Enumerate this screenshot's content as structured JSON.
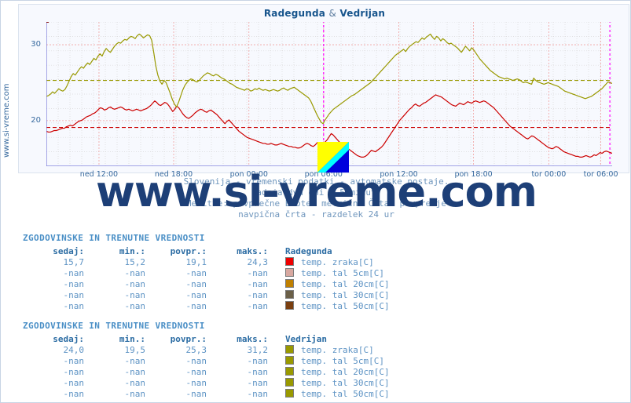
{
  "page": {
    "side_watermark": "www.si-vreme.com",
    "center_watermark": "www.si-vreme.com"
  },
  "chart": {
    "title_left": "Radegunda",
    "title_amp": "&",
    "title_right": "Vedrijan",
    "caption_line1": "Slovenija - vremenski podatki - avtomatske postaje.",
    "caption_line2": "zadnja dva dni / 5 minut.",
    "caption_line3": "Meritve: povprečne  Enote: metrične  Črta: povprečje",
    "caption_line4": "navpična črta - razdelek 24 ur",
    "logo_colors": {
      "top": "#ffff00",
      "mid": "#00ffff",
      "bottom": "#0000dd"
    }
  },
  "chart_data": {
    "type": "line",
    "title": "Radegunda & Vedrijan",
    "xlabel": "",
    "ylabel": "",
    "ylim": [
      14,
      33
    ],
    "yticks": [
      20,
      30
    ],
    "ytick_labels": [
      "20",
      "30"
    ],
    "grid": true,
    "xtick_labels": [
      "ned 12:00",
      "ned 18:00",
      "pon 00:00",
      "pon 06:00",
      "pon 12:00",
      "pon 18:00",
      "tor 00:00",
      "tor 06:00"
    ],
    "xtick_positions_pct": [
      9.3,
      22.5,
      35.8,
      49.0,
      62.3,
      75.5,
      88.8,
      98.0
    ],
    "day_divider_pct": [
      49.0,
      99.6
    ],
    "day_divider_color": "#ff00ff",
    "series": [
      {
        "name": "Radegunda temp. zraka[C]",
        "color": "#cc0000",
        "average": 19.1,
        "average_line_color": "#cc0000",
        "values": [
          18.6,
          18.5,
          18.5,
          18.6,
          18.7,
          18.7,
          18.8,
          18.9,
          19.0,
          19.0,
          19.2,
          19.3,
          19.4,
          19.3,
          19.5,
          19.7,
          19.9,
          20.0,
          20.1,
          20.3,
          20.5,
          20.6,
          20.7,
          20.9,
          21.0,
          21.2,
          21.5,
          21.7,
          21.6,
          21.4,
          21.5,
          21.7,
          21.8,
          21.6,
          21.5,
          21.6,
          21.7,
          21.8,
          21.7,
          21.5,
          21.4,
          21.5,
          21.4,
          21.3,
          21.4,
          21.5,
          21.4,
          21.3,
          21.4,
          21.5,
          21.6,
          21.8,
          22.0,
          22.3,
          22.6,
          22.4,
          22.1,
          22.0,
          22.2,
          22.4,
          22.3,
          22.0,
          21.6,
          21.2,
          21.5,
          21.9,
          21.7,
          21.3,
          20.9,
          20.6,
          20.4,
          20.3,
          20.5,
          20.7,
          21.0,
          21.2,
          21.4,
          21.5,
          21.4,
          21.2,
          21.1,
          21.3,
          21.4,
          21.2,
          21.0,
          20.8,
          20.5,
          20.2,
          19.9,
          19.6,
          19.9,
          20.1,
          19.8,
          19.5,
          19.2,
          18.9,
          18.6,
          18.4,
          18.2,
          18.0,
          17.8,
          17.7,
          17.6,
          17.5,
          17.4,
          17.3,
          17.2,
          17.1,
          17.0,
          17.0,
          16.9,
          16.9,
          17.0,
          16.9,
          16.8,
          16.8,
          16.9,
          17.0,
          16.9,
          16.8,
          16.7,
          16.6,
          16.6,
          16.5,
          16.5,
          16.4,
          16.4,
          16.5,
          16.7,
          16.9,
          17.0,
          16.9,
          16.7,
          16.6,
          16.8,
          17.1,
          17.0,
          16.8,
          16.9,
          17.2,
          17.5,
          17.9,
          18.3,
          18.1,
          17.8,
          17.5,
          17.2,
          17.0,
          16.8,
          16.6,
          16.4,
          16.2,
          16.0,
          15.8,
          15.6,
          15.4,
          15.3,
          15.2,
          15.2,
          15.3,
          15.5,
          15.8,
          16.1,
          16.0,
          15.9,
          16.1,
          16.3,
          16.5,
          16.8,
          17.2,
          17.6,
          18.0,
          18.4,
          18.8,
          19.2,
          19.6,
          20.0,
          20.3,
          20.6,
          20.9,
          21.2,
          21.5,
          21.7,
          22.0,
          22.2,
          22.0,
          21.9,
          22.1,
          22.3,
          22.4,
          22.6,
          22.8,
          23.0,
          23.2,
          23.4,
          23.3,
          23.2,
          23.1,
          22.9,
          22.7,
          22.5,
          22.3,
          22.1,
          22.0,
          21.9,
          22.1,
          22.3,
          22.2,
          22.1,
          22.3,
          22.5,
          22.4,
          22.3,
          22.5,
          22.6,
          22.5,
          22.4,
          22.5,
          22.6,
          22.5,
          22.3,
          22.1,
          21.9,
          21.7,
          21.4,
          21.1,
          20.8,
          20.5,
          20.2,
          19.9,
          19.6,
          19.3,
          19.1,
          18.9,
          18.7,
          18.5,
          18.3,
          18.1,
          17.9,
          17.7,
          17.6,
          17.8,
          18.0,
          17.9,
          17.7,
          17.5,
          17.3,
          17.1,
          16.9,
          16.7,
          16.5,
          16.4,
          16.3,
          16.4,
          16.6,
          16.5,
          16.3,
          16.1,
          15.9,
          15.8,
          15.7,
          15.6,
          15.5,
          15.4,
          15.3,
          15.3,
          15.2,
          15.2,
          15.3,
          15.4,
          15.3,
          15.2,
          15.3,
          15.5,
          15.4,
          15.6,
          15.8,
          15.7,
          15.9,
          16.0,
          15.9,
          15.8,
          15.7
        ]
      },
      {
        "name": "Vedrijan temp. zraka[C]",
        "color": "#999900",
        "average": 25.3,
        "average_line_color": "#999900",
        "values": [
          23.2,
          23.3,
          23.5,
          23.8,
          23.6,
          23.9,
          24.2,
          24.0,
          23.9,
          24.1,
          24.6,
          25.2,
          25.8,
          26.2,
          26.0,
          26.4,
          26.8,
          27.1,
          26.9,
          27.3,
          27.6,
          27.4,
          27.8,
          28.2,
          28.0,
          28.5,
          28.8,
          28.5,
          29.1,
          29.5,
          29.2,
          29.0,
          29.4,
          29.8,
          30.1,
          30.3,
          30.2,
          30.5,
          30.7,
          30.6,
          30.9,
          31.1,
          31.0,
          30.8,
          31.2,
          31.4,
          31.2,
          30.9,
          31.1,
          31.3,
          31.2,
          30.6,
          29.0,
          27.2,
          26.0,
          25.2,
          24.8,
          25.3,
          25.0,
          24.3,
          23.6,
          22.8,
          22.2,
          21.8,
          22.4,
          23.2,
          24.0,
          24.6,
          25.0,
          25.3,
          25.5,
          25.4,
          25.2,
          25.1,
          25.3,
          25.6,
          25.9,
          26.1,
          26.3,
          26.2,
          26.0,
          25.9,
          26.1,
          26.0,
          25.8,
          25.6,
          25.5,
          25.3,
          25.1,
          24.9,
          24.8,
          24.6,
          24.4,
          24.3,
          24.2,
          24.1,
          24.0,
          24.2,
          24.1,
          23.9,
          24.0,
          24.2,
          24.1,
          24.3,
          24.1,
          24.0,
          24.1,
          24.0,
          23.9,
          24.0,
          24.1,
          24.0,
          23.9,
          24.0,
          24.2,
          24.3,
          24.1,
          24.0,
          24.2,
          24.3,
          24.4,
          24.2,
          24.0,
          23.8,
          23.6,
          23.4,
          23.2,
          23.0,
          22.6,
          22.0,
          21.4,
          20.8,
          20.3,
          19.8,
          19.6,
          20.1,
          20.5,
          20.9,
          21.2,
          21.5,
          21.7,
          21.9,
          22.1,
          22.3,
          22.5,
          22.7,
          22.9,
          23.1,
          23.3,
          23.4,
          23.6,
          23.8,
          24.0,
          24.2,
          24.4,
          24.6,
          24.8,
          25.0,
          25.3,
          25.6,
          25.9,
          26.2,
          26.5,
          26.8,
          27.1,
          27.4,
          27.7,
          28.0,
          28.3,
          28.6,
          28.8,
          29.0,
          29.2,
          29.4,
          29.1,
          29.5,
          29.8,
          30.0,
          30.2,
          30.4,
          30.3,
          30.6,
          30.9,
          30.7,
          31.0,
          31.2,
          31.4,
          31.0,
          30.7,
          31.1,
          30.9,
          30.5,
          30.8,
          30.6,
          30.3,
          30.1,
          30.2,
          30.0,
          29.8,
          29.6,
          29.3,
          29.0,
          29.4,
          29.8,
          29.5,
          29.2,
          29.6,
          29.3,
          28.9,
          28.5,
          28.1,
          27.8,
          27.5,
          27.2,
          26.9,
          26.6,
          26.4,
          26.2,
          26.0,
          25.8,
          25.7,
          25.6,
          25.5,
          25.6,
          25.5,
          25.4,
          25.3,
          25.4,
          25.5,
          25.4,
          25.2,
          25.0,
          25.1,
          25.0,
          24.9,
          24.8,
          25.6,
          25.3,
          25.1,
          25.0,
          24.9,
          24.8,
          24.9,
          25.0,
          24.9,
          24.8,
          24.7,
          24.6,
          24.5,
          24.3,
          24.1,
          23.9,
          23.8,
          23.7,
          23.6,
          23.5,
          23.4,
          23.3,
          23.2,
          23.1,
          23.0,
          22.9,
          23.0,
          23.1,
          23.2,
          23.4,
          23.6,
          23.8,
          24.0,
          24.2,
          24.5,
          24.8,
          25.1,
          25.0,
          24.9
        ]
      }
    ]
  },
  "tables": [
    {
      "heading": "ZGODOVINSKE IN TRENUTNE VREDNOSTI",
      "station": "Radegunda",
      "columns": [
        "sedaj:",
        "min.:",
        "povpr.:",
        "maks.:"
      ],
      "rows": [
        {
          "now": "15,7",
          "min": "15,2",
          "avg": "19,1",
          "max": "24,3",
          "color": "#ee0000",
          "label": "temp. zraka[C]"
        },
        {
          "now": "-nan",
          "min": "-nan",
          "avg": "-nan",
          "max": "-nan",
          "color": "#d8a8a0",
          "label": "temp. tal  5cm[C]"
        },
        {
          "now": "-nan",
          "min": "-nan",
          "avg": "-nan",
          "max": "-nan",
          "color": "#c08000",
          "label": "temp. tal 20cm[C]"
        },
        {
          "now": "-nan",
          "min": "-nan",
          "avg": "-nan",
          "max": "-nan",
          "color": "#6b6048",
          "label": "temp. tal 30cm[C]"
        },
        {
          "now": "-nan",
          "min": "-nan",
          "avg": "-nan",
          "max": "-nan",
          "color": "#7a3f10",
          "label": "temp. tal 50cm[C]"
        }
      ]
    },
    {
      "heading": "ZGODOVINSKE IN TRENUTNE VREDNOSTI",
      "station": "Vedrijan",
      "columns": [
        "sedaj:",
        "min.:",
        "povpr.:",
        "maks.:"
      ],
      "rows": [
        {
          "now": "24,0",
          "min": "19,5",
          "avg": "25,3",
          "max": "31,2",
          "color": "#999900",
          "label": "temp. zraka[C]"
        },
        {
          "now": "-nan",
          "min": "-nan",
          "avg": "-nan",
          "max": "-nan",
          "color": "#999900",
          "label": "temp. tal  5cm[C]"
        },
        {
          "now": "-nan",
          "min": "-nan",
          "avg": "-nan",
          "max": "-nan",
          "color": "#999900",
          "label": "temp. tal 20cm[C]"
        },
        {
          "now": "-nan",
          "min": "-nan",
          "avg": "-nan",
          "max": "-nan",
          "color": "#999900",
          "label": "temp. tal 30cm[C]"
        },
        {
          "now": "-nan",
          "min": "-nan",
          "avg": "-nan",
          "max": "-nan",
          "color": "#999900",
          "label": "temp. tal 50cm[C]"
        }
      ]
    }
  ]
}
